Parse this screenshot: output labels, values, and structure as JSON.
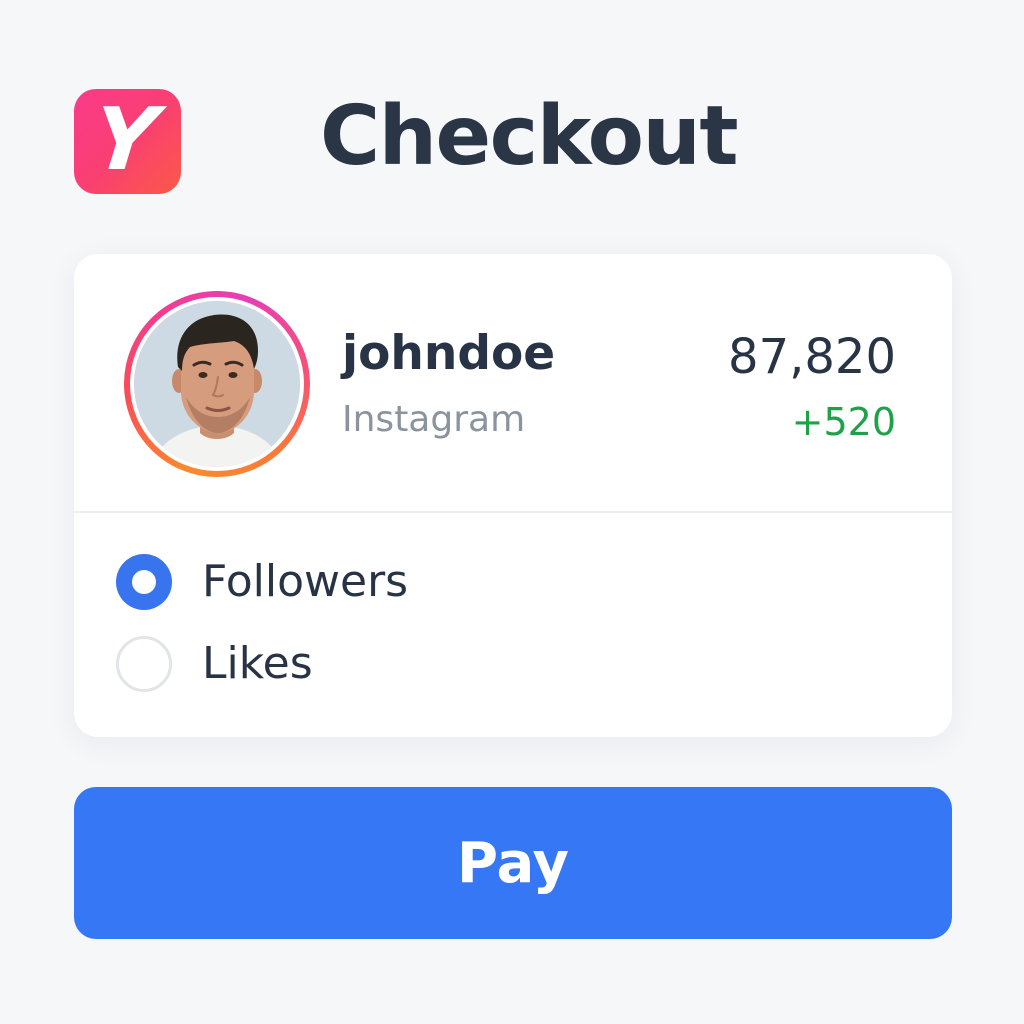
{
  "app": {
    "logo_letter": "Y",
    "logo_colors": [
      "#fb3a8b",
      "#fb5a45"
    ]
  },
  "header": {
    "title": "Checkout"
  },
  "account": {
    "username": "johndoe",
    "platform": "Instagram",
    "count": "87,820",
    "delta": "+520",
    "delta_color": "#1fa14a",
    "avatar_icon": "profile-photo"
  },
  "options": [
    {
      "label": "Followers",
      "selected": true
    },
    {
      "label": "Likes",
      "selected": false
    }
  ],
  "actions": {
    "pay_label": "Pay",
    "pay_color": "#3677f5"
  },
  "colors": {
    "background": "#f6f7f9",
    "text": "#283345",
    "muted": "#8a949e",
    "radio_selected": "#3874ee"
  }
}
